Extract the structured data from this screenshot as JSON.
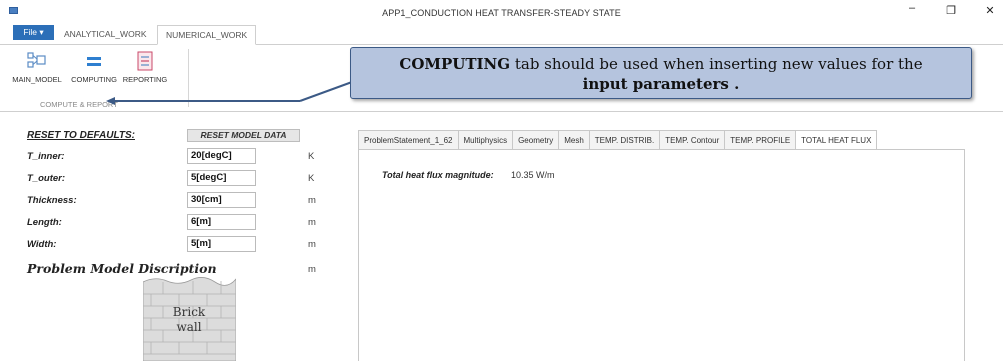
{
  "window": {
    "title": "APP1_CONDUCTION HEAT TRANSFER-STEADY STATE",
    "minimize_symbol": "–",
    "maximize_symbol": "❐",
    "close_symbol": "✕"
  },
  "ribbon": {
    "file_label": "File ▾",
    "tabs": [
      {
        "label": "ANALYTICAL_WORK"
      },
      {
        "label": "NUMERICAL_WORK",
        "selected": true
      }
    ],
    "buttons": [
      {
        "label": "MAIN_MODEL",
        "icon": "main-model-icon"
      },
      {
        "label": "COMPUTING",
        "icon": "computing-icon",
        "selected": true
      },
      {
        "label": "REPORTING",
        "icon": "reporting-icon"
      }
    ],
    "group_label": "COMPUTE & REPORT"
  },
  "callout": {
    "bold_text": "COMPUTING",
    "text_1": " tab should be used when inserting new values for the",
    "text_2": "input parameters ."
  },
  "parameters": {
    "reset_link": "RESET TO DEFAULTS:",
    "reset_button": "RESET MODEL DATA",
    "rows": [
      {
        "label": "T_inner:",
        "value": "20[degC]",
        "unit": "K"
      },
      {
        "label": "T_outer:",
        "value": "5[degC]",
        "unit": "K"
      },
      {
        "label": "Thickness:",
        "value": "30[cm]",
        "unit": "m"
      },
      {
        "label": "Length:",
        "value": "6[m]",
        "unit": "m"
      },
      {
        "label": "Width:",
        "value": "5[m]",
        "unit": "m"
      }
    ],
    "model_description_title": "Problem Model Discription",
    "model_description_unit": "m",
    "brick_line1": "Brick",
    "brick_line2": "wall"
  },
  "results": {
    "tabs": [
      {
        "label": "ProblemStatement_1_62"
      },
      {
        "label": "Multiphysics"
      },
      {
        "label": "Geometry"
      },
      {
        "label": "Mesh"
      },
      {
        "label": "TEMP. DISTRIB."
      },
      {
        "label": "TEMP. Contour"
      },
      {
        "label": "TEMP. PROFILE"
      },
      {
        "label": "TOTAL HEAT FLUX",
        "selected": true
      }
    ],
    "flux_label": "Total heat flux magnitude:",
    "flux_value": "10.35 W/m"
  },
  "colors": {
    "file_tab": "#2c6fb8",
    "callout_fill": "#b5c4de",
    "callout_border": "#3c5a86",
    "computing_highlight": "#cfe4f7"
  }
}
